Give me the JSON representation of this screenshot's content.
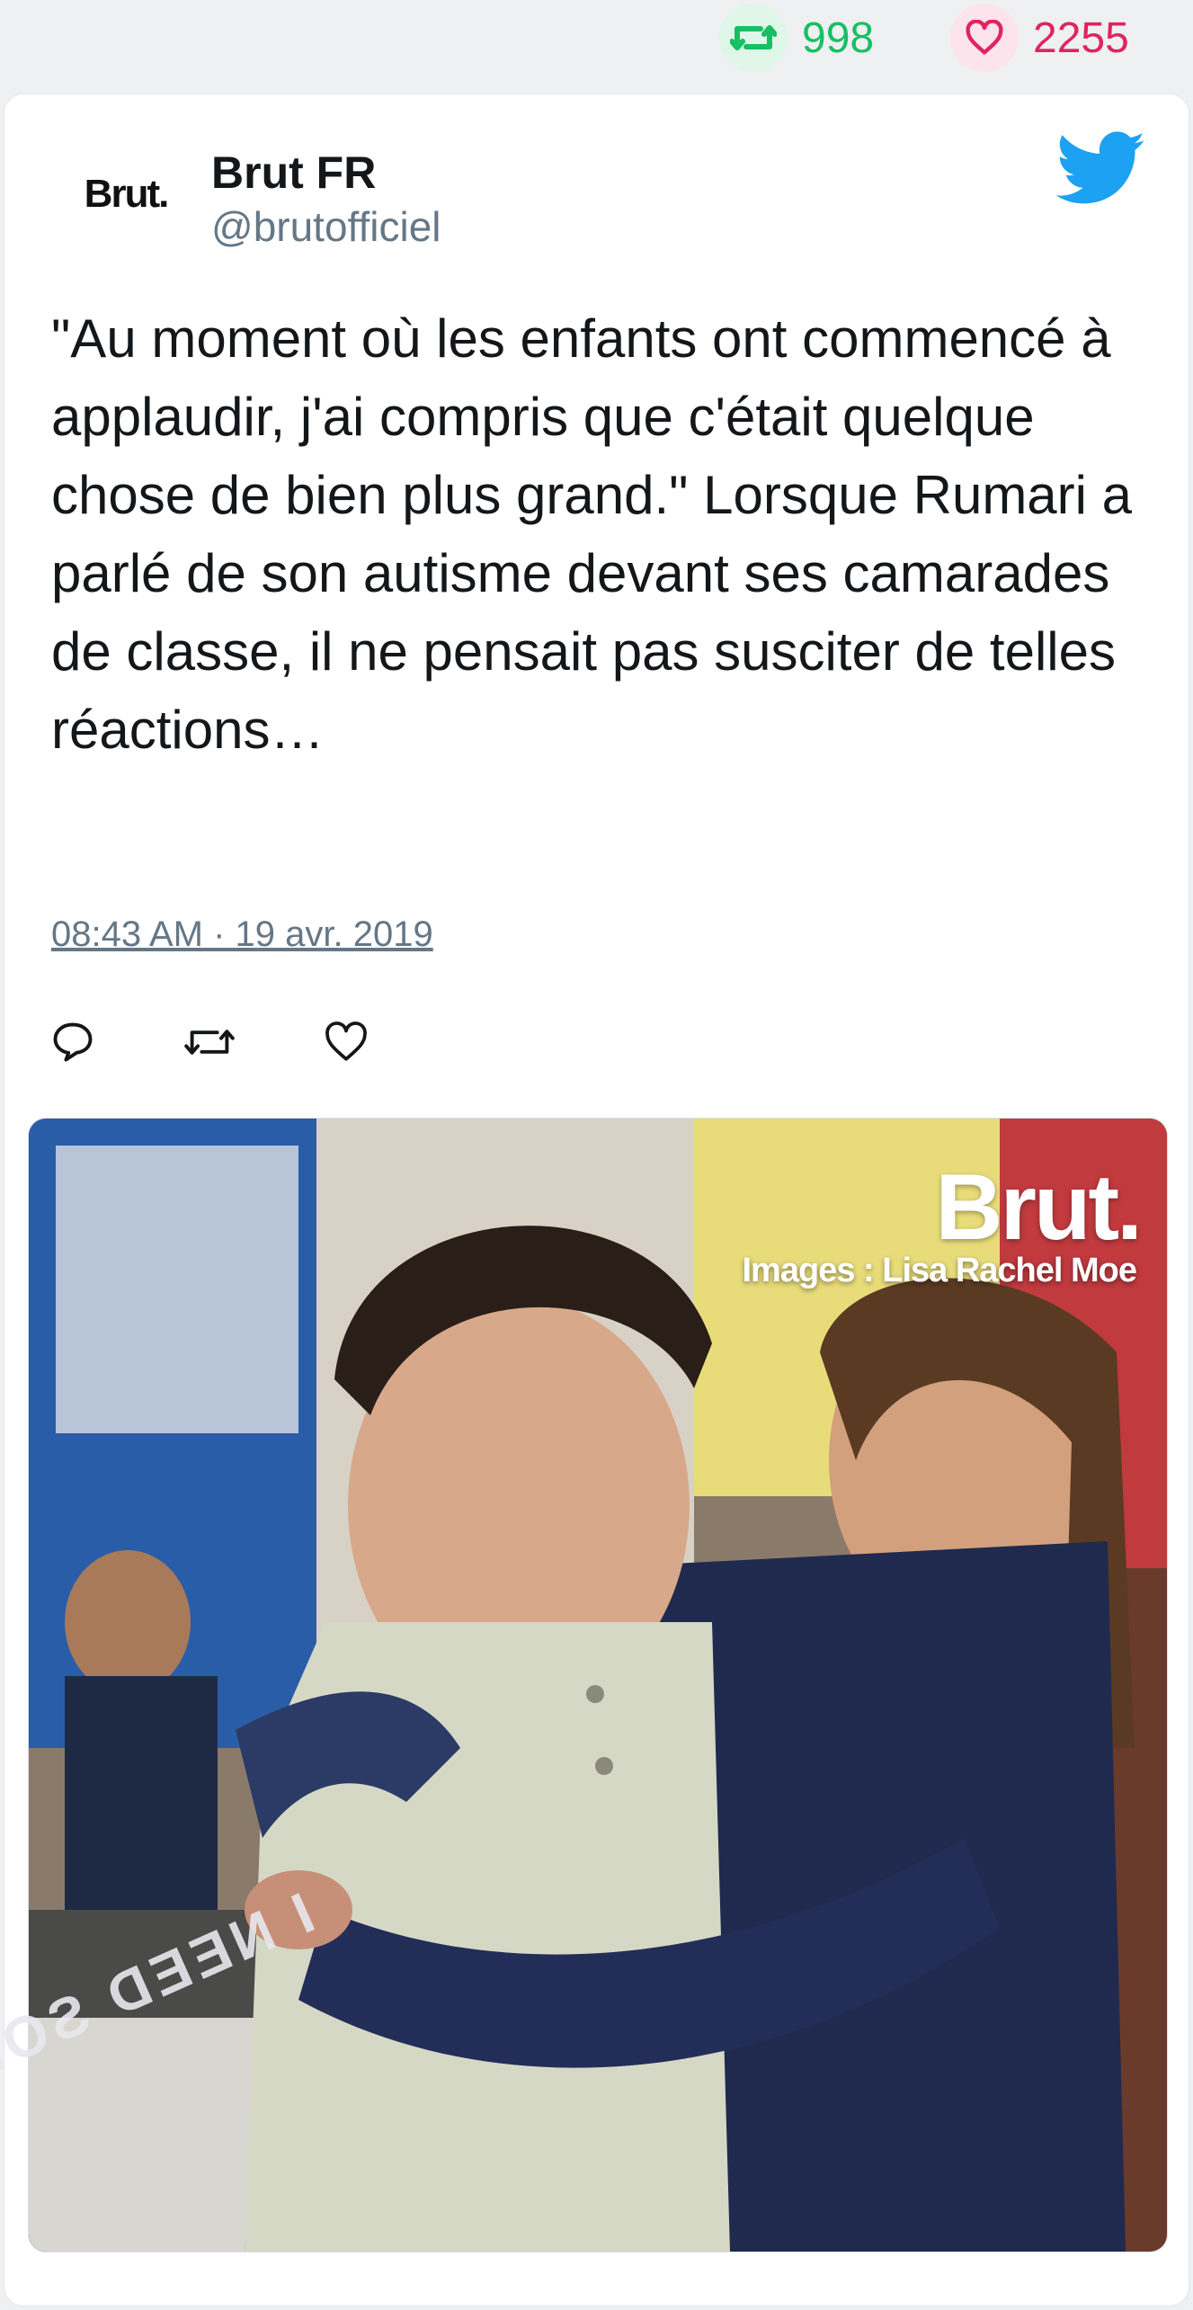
{
  "stats": {
    "retweets": "998",
    "likes": "2255",
    "retweet_icon": "retweet-icon",
    "like_icon": "heart-icon",
    "retweet_color": "#17bf63",
    "like_color": "#e0245e"
  },
  "tweet": {
    "avatar_text": "Brut.",
    "display_name": "Brut FR",
    "handle": "@brutofficiel",
    "text": "\"Au moment où les enfants ont commencé à applaudir, j'ai compris que c'était quelque chose de bien plus grand.\" Lorsque Rumari a parlé de son autisme devant ses camarades de classe, il ne pensait pas susciter de telles réactions…",
    "timestamp": "08:43 AM · 19 avr. 2019",
    "brand_color": "#1da1f2",
    "actions": [
      "reply-icon",
      "retweet-icon",
      "heart-icon"
    ]
  },
  "media": {
    "watermark_brand": "Brut.",
    "watermark_credit": "Images : Lisa Rachel Moe",
    "shirt_text": "I NEED SOME SPACE"
  }
}
